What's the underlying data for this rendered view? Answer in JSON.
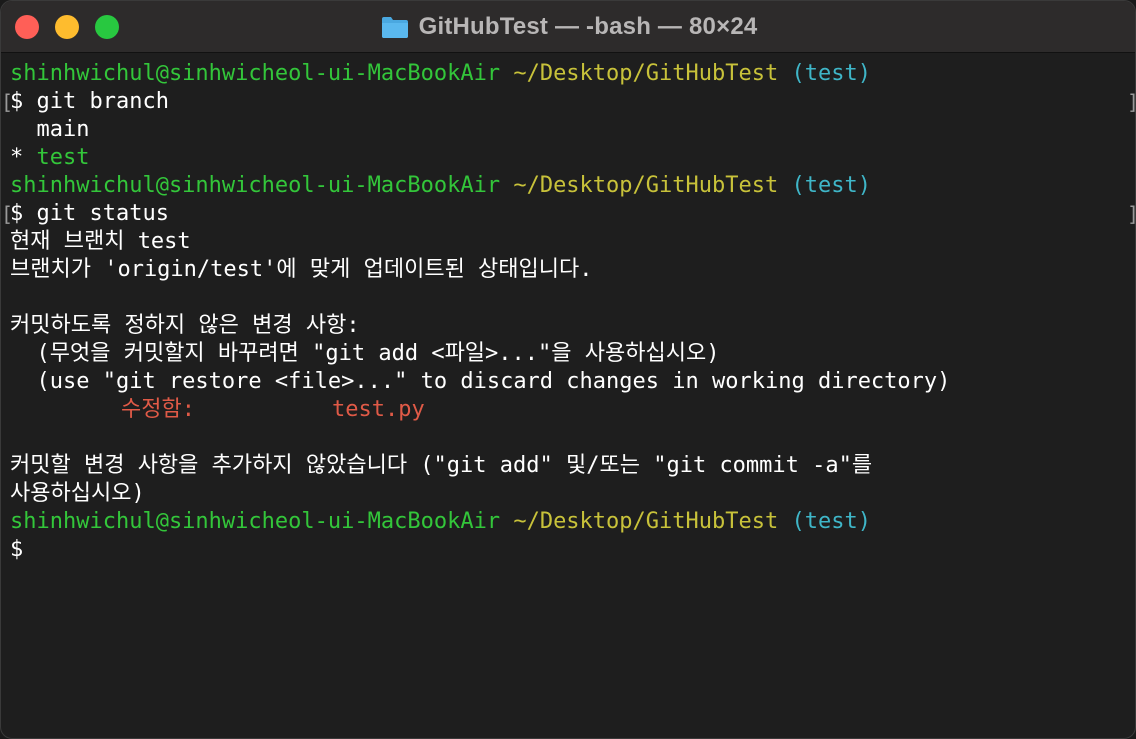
{
  "window": {
    "title": "GitHubTest — -bash — 80×24",
    "title_icon": "folder-icon"
  },
  "prompt": {
    "user_host": "shinhwichul@sinhwicheol-ui-MacBookAir",
    "path": "~/Desktop/GitHubTest",
    "branch": "(test)",
    "dollar": "$"
  },
  "lines": {
    "cmd1": "git branch",
    "branch_main": "  main",
    "branch_star": "* ",
    "branch_test": "test",
    "cmd2": "git status",
    "status1": "현재 브랜치 test",
    "status2": "브랜치가 'origin/test'에 맞게 업데이트된 상태입니다.",
    "status3": "커밋하도록 정하지 않은 변경 사항:",
    "status4": "  (무엇을 커밋할지 바꾸려면 \"git add <파일>...\"을 사용하십시오)",
    "status5": "  (use \"git restore <file>...\" to discard changes in working directory)",
    "modified_label": "수정함:",
    "modified_file": "test.py",
    "status6": "커밋할 변경 사항을 추가하지 않았습니다 (\"git add\" 및/또는 \"git commit -a\"를",
    "status7": "사용하십시오)"
  },
  "colors": {
    "user_host": "#33c63a",
    "path": "#c8c23a",
    "branch": "#3fb6c8",
    "modified": "#e05a47",
    "background": "#1e1e1e"
  }
}
